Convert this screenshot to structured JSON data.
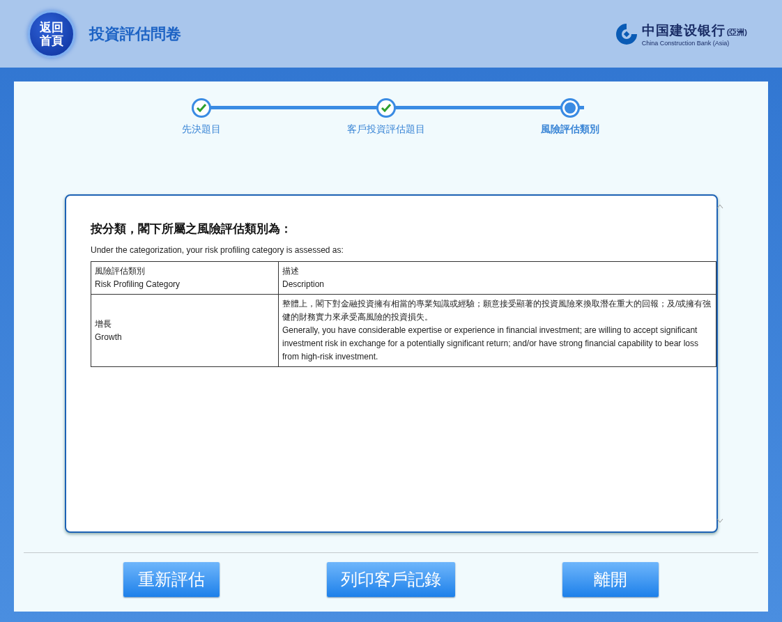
{
  "header": {
    "home_button": {
      "lines": [
        "返回",
        "首頁"
      ]
    },
    "title": "投資評估問卷",
    "logo": {
      "chinese": "中国建设银行",
      "region": "(亞洲)",
      "english": "China Construction Bank (Asia)"
    }
  },
  "steps": [
    {
      "label": "先決題目",
      "completed": true,
      "selected": false
    },
    {
      "label": "客戶投資評估題目",
      "completed": true,
      "selected": false
    },
    {
      "label": "風險評估類別",
      "completed": false,
      "selected": true
    }
  ],
  "result": {
    "heading": "按分類，閣下所屬之風險評估類別為：",
    "subheading": "Under the categorization, your risk profiling category is assessed as:",
    "table": {
      "columns": [
        {
          "chinese": "風險評估類別",
          "english": "Risk Profiling Category"
        },
        {
          "chinese": "描述",
          "english": "Description"
        }
      ],
      "rows": [
        {
          "category": {
            "chinese": "增長",
            "english": "Growth"
          },
          "description": {
            "chinese": "整體上，閣下對金融投資擁有相當的專業知識或經驗；願意接受顯著的投資風險來換取潛在重大的回報；及/或擁有強健的財務實力來承受高風險的投資損失。",
            "english": "Generally, you have considerable expertise or experience in financial investment; are willing to accept significant investment risk in exchange for a potentially significant return; and/or have strong financial capability to bear loss from high-risk investment."
          }
        }
      ]
    }
  },
  "buttons": [
    "重新評估",
    "列印客戶記錄",
    "離開"
  ]
}
